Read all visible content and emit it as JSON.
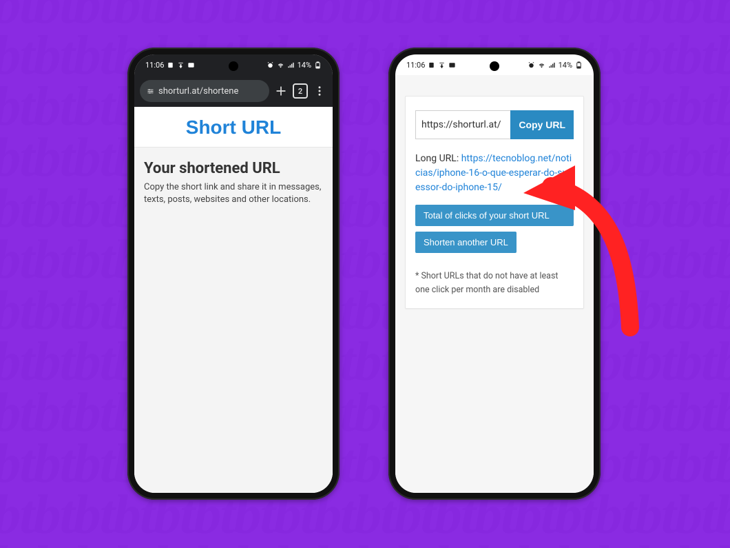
{
  "status": {
    "time": "11:06",
    "battery_text": "14%"
  },
  "browser": {
    "url_display": "shorturl.at/shortene",
    "tab_count": "2"
  },
  "left_page": {
    "site_title": "Short URL",
    "heading": "Your shortened URL",
    "subtext": "Copy the short link and share it in messages, texts, posts, websites and other locations."
  },
  "right_page": {
    "short_url_value": "https://shorturl.at/",
    "copy_button": "Copy URL",
    "long_label": "Long URL: ",
    "long_url_display": "https://tecnoblog.net/noticias/iphone-16-o-que-esperar-do-sucessor-do-iphone-15/",
    "stats_button": "Total of clicks of your short URL",
    "another_button": "Shorten another URL",
    "disclaimer": "* Short URLs that do not have at least one click per month are disabled"
  }
}
